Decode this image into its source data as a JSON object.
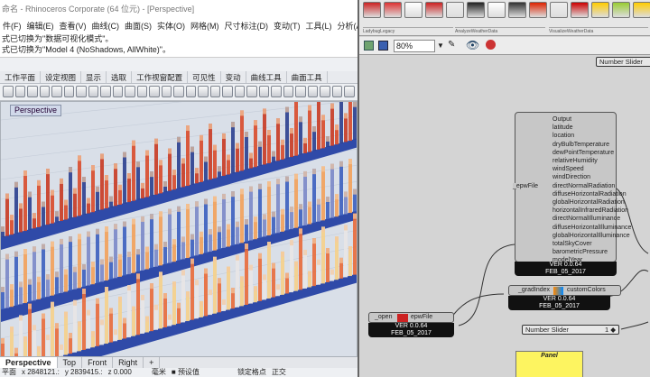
{
  "rhino": {
    "title": "命名 - Rhinoceros Corporate (64 位元) - [Perspective]",
    "menu": [
      "件(F)",
      "编辑(E)",
      "查看(V)",
      "曲线(C)",
      "曲面(S)",
      "实体(O)",
      "网格(M)",
      "尺寸标注(D)",
      "变动(T)",
      "工具(L)",
      "分析(A)"
    ],
    "command_lines": [
      "式已切换为\"数据可视化模式\"。",
      "式已切换为\"Model 4 (NoShadows, AllWhite)\"。"
    ],
    "toolbar_tabs": [
      "工作平面",
      "设定视图",
      "显示",
      "选取",
      "工作视窗配置",
      "可见性",
      "变动",
      "曲线工具",
      "曲面工具"
    ],
    "viewport_label": "Perspective",
    "viewport_tabs": [
      "Perspective",
      "Top",
      "Front",
      "Right"
    ],
    "viewport_add": "+",
    "status": {
      "cplane": "平面",
      "x": "x 2848121.:",
      "y": "y 2839415.:",
      "z": "z 0.000",
      "units": "毫米",
      "layer": "预设值",
      "osnap": "锁定格点",
      "ortho": "正交"
    }
  },
  "grasshopper": {
    "tab_groups": [
      "LadybugLegacy",
      "AnalyzeWeatherData",
      "VisualizeWeatherData"
    ],
    "zoom": "80%",
    "number_slider_top": "Number Slider",
    "epw_component": {
      "input": "_epwFile",
      "outputs": [
        "Output",
        "latitude",
        "location",
        "dryBulbTemperature",
        "dewPointTemperature",
        "relativeHumidity",
        "windSpeed",
        "windDirection",
        "directNormalRadiation",
        "diffuseHorizontalRadiation",
        "globalHorizontalRadiation",
        "horizontalInfraredRadiation",
        "directNormalIlluminance",
        "diffuseHorizontalIlluminance",
        "globalHorizontalIlluminance",
        "totalSkyCover",
        "barometricPressure",
        "modelYear"
      ],
      "version": "VER 0.0.64",
      "date": "FEB_05_2017"
    },
    "colors_component": {
      "input": "_gradIndex",
      "output": "customColors",
      "version": "VER 0.0.64",
      "date": "FEB_05_2017"
    },
    "open_component": {
      "input": "_open",
      "output": "epwFile",
      "version": "VER 0.0.64",
      "date": "FEB_05_2017"
    },
    "number_slider_bottom": {
      "label": "Number Slider",
      "value": "1 ◆"
    },
    "panel_label": "Panel"
  }
}
